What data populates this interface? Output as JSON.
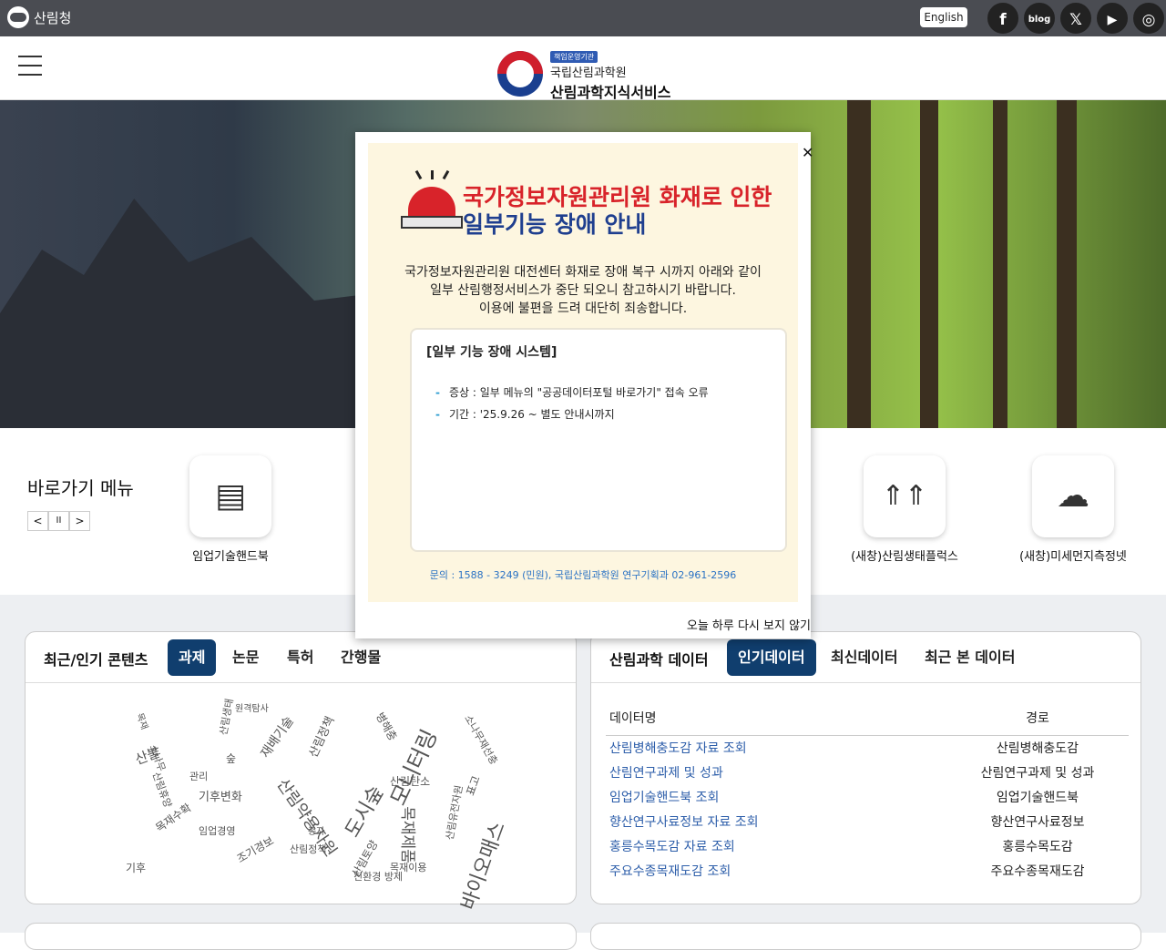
{
  "topbar": {
    "org_name": "산림청",
    "english_label": "English",
    "social": [
      {
        "name": "facebook-icon",
        "glyph": "f"
      },
      {
        "name": "blog-icon",
        "glyph": "blog"
      },
      {
        "name": "x-icon",
        "glyph": "𝕏"
      },
      {
        "name": "youtube-icon",
        "glyph": "▶"
      },
      {
        "name": "instagram-icon",
        "glyph": "◎"
      }
    ]
  },
  "header": {
    "badge": "책임운영기관",
    "org": "국립산림과학원",
    "service": "산림과학지식서비스"
  },
  "quick_menu": {
    "title": "바로가기 메뉴",
    "prev": "<",
    "pause": "II",
    "next": ">",
    "items": [
      {
        "label": "임업기술핸드북",
        "icon": "book-icon"
      },
      {
        "label": "(새창)산림생태플럭스",
        "icon": "tree-icon"
      },
      {
        "label": "(새창)미세먼지측정넷",
        "icon": "rain-cloud-icon"
      }
    ]
  },
  "left_panel": {
    "title": "최근/인기 콘텐츠",
    "tabs": [
      "과제",
      "논문",
      "특허",
      "간행물"
    ],
    "active_tab": "과제",
    "cloud_words": [
      "산불",
      "관리",
      "기후변화",
      "도시숲",
      "산림약용자원",
      "모니터링",
      "바이오매스",
      "목재제품",
      "재배기술",
      "산림정책",
      "소나무",
      "병해충",
      "산림탄소",
      "목재수확",
      "산림휴양",
      "산림생태",
      "원격탐사",
      "조기경보",
      "친환경 방제",
      "목재이용",
      "기후",
      "임업경영",
      "산림유전자원",
      "종자",
      "산림정책",
      "목재",
      "숲",
      "산림토양",
      "소나무재선충",
      "표고"
    ]
  },
  "right_panel": {
    "title": "산림과학 데이터",
    "tabs": [
      "인기데이터",
      "최신데이터",
      "최근 본 데이터"
    ],
    "active_tab": "인기데이터",
    "col_name": "데이터명",
    "col_path": "경로",
    "rows": [
      {
        "name": "산림병해충도감 자료 조회",
        "path": "산림병해충도감"
      },
      {
        "name": "산림연구과제 및 성과",
        "path": "산림연구과제 및 성과"
      },
      {
        "name": "임업기술핸드북 조회",
        "path": "임업기술핸드북"
      },
      {
        "name": "향산연구사료정보 자료 조회",
        "path": "향산연구사료정보"
      },
      {
        "name": "홍릉수목도감 자료 조회",
        "path": "홍릉수목도감"
      },
      {
        "name": "주요수종목재도감 조회",
        "path": "주요수종목재도감"
      }
    ]
  },
  "popup": {
    "title_line1": "국가정보자원관리원 화재로 인한",
    "title_line2": "일부기능 장애 안내",
    "message_line1": "국가정보자원관리원 대전센터 화재로 장애 복구 시까지 아래와 같이",
    "message_line2": "일부 산림행정서비스가 중단 되오니 참고하시기 바랍니다.",
    "message_line3": "이용에 불편을 드려 대단히 죄송합니다.",
    "box_title": "[일부 기능 장애 시스템]",
    "item1": "증상 : 일부 메뉴의 \"공공데이터포털 바로가기\" 접속 오류",
    "item2": "기간 : '25.9.26 ~ 별도 안내시까지",
    "contact": "문의 : 1588 - 3249 (민원), 국립산림과학원 연구기획과 02-961-2596",
    "no_show": "오늘 하루 다시 보지 않기"
  },
  "colors": {
    "topbar": "#4a4c52",
    "active_tab": "#103e6e",
    "link": "#2d5eaa",
    "alert_red": "#d8232a",
    "alert_blue": "#1f3f8f"
  }
}
